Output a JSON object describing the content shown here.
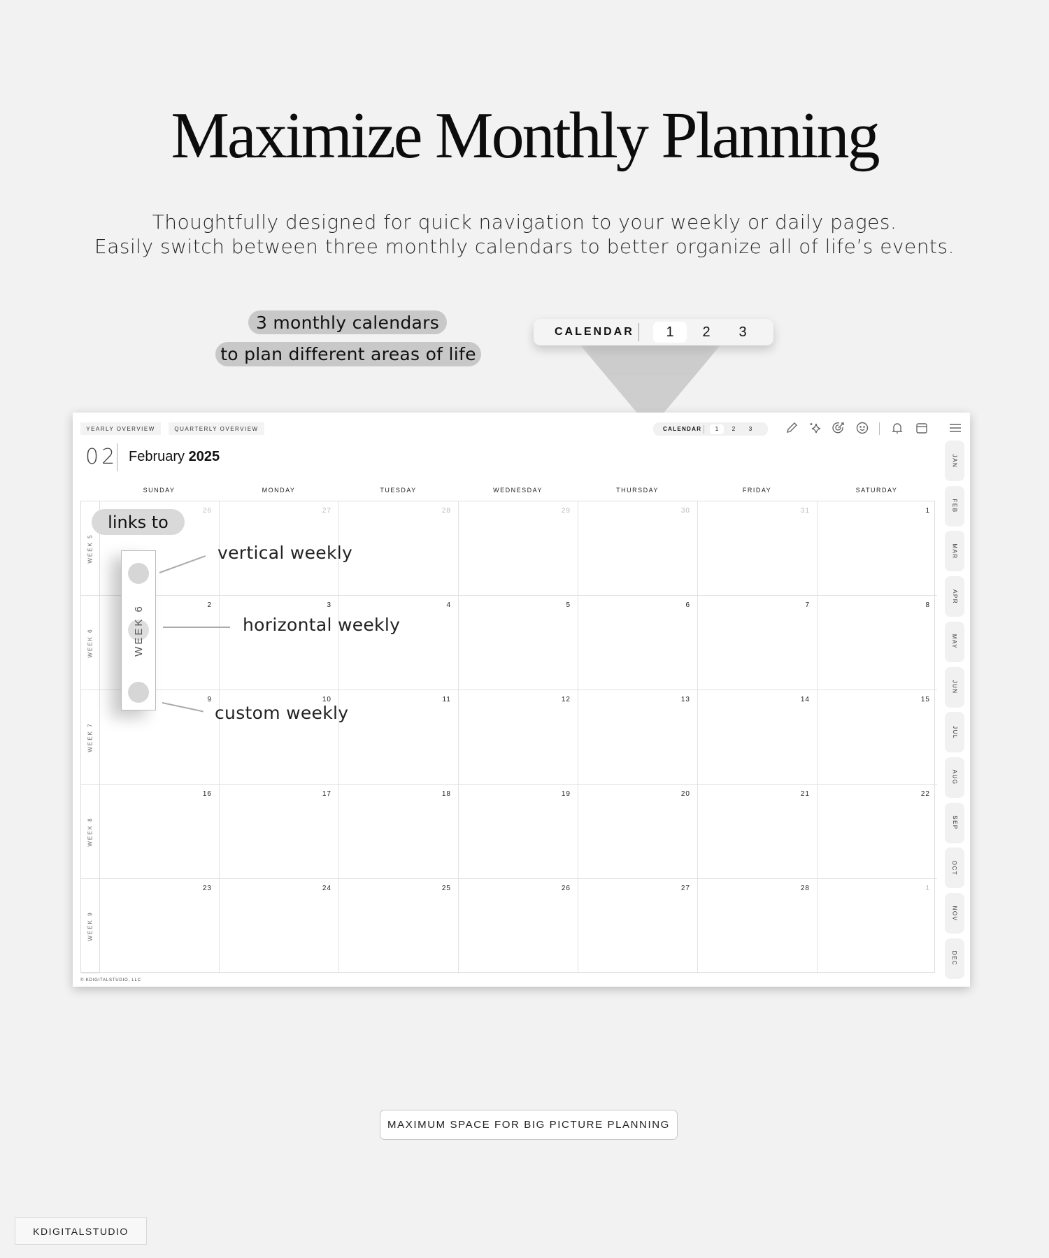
{
  "hero": {
    "title": "Maximize Monthly Planning",
    "subtitle_line1": "Thoughtfully designed for quick navigation to your weekly or daily pages.",
    "subtitle_line2": "Easily switch between three monthly calendars to better organize all of life’s events."
  },
  "annotations": {
    "note_line1": "3 monthly calendars",
    "note_line2": "to plan different areas of life",
    "links_to": "links to",
    "popup_week": "WEEK 6",
    "callouts": [
      "vertical weekly",
      "horizontal weekly",
      "custom weekly"
    ]
  },
  "calendar_switcher": {
    "label": "CALENDAR",
    "options": [
      "1",
      "2",
      "3"
    ],
    "active": "1"
  },
  "planner": {
    "nav_tabs": [
      "YEARLY OVERVIEW",
      "QUARTERLY OVERVIEW"
    ],
    "toolbar_icons": [
      "pencil-icon",
      "sparkle-icon",
      "target-icon",
      "smiley-icon",
      "bell-icon",
      "calendar-icon",
      "menu-icon"
    ],
    "month_number": "02",
    "month_name": "February",
    "year": "2025",
    "weekdays": [
      "SUNDAY",
      "MONDAY",
      "TUESDAY",
      "WEDNESDAY",
      "THURSDAY",
      "FRIDAY",
      "SATURDAY"
    ],
    "weeks": [
      {
        "label": "WEEK 5",
        "days": [
          {
            "n": "26",
            "dim": true
          },
          {
            "n": "27",
            "dim": true
          },
          {
            "n": "28",
            "dim": true
          },
          {
            "n": "29",
            "dim": true
          },
          {
            "n": "30",
            "dim": true
          },
          {
            "n": "31",
            "dim": true
          },
          {
            "n": "1",
            "dim": false
          }
        ]
      },
      {
        "label": "WEEK 6",
        "days": [
          {
            "n": "2",
            "dim": false
          },
          {
            "n": "3",
            "dim": false
          },
          {
            "n": "4",
            "dim": false
          },
          {
            "n": "5",
            "dim": false
          },
          {
            "n": "6",
            "dim": false
          },
          {
            "n": "7",
            "dim": false
          },
          {
            "n": "8",
            "dim": false
          }
        ]
      },
      {
        "label": "WEEK 7",
        "days": [
          {
            "n": "9",
            "dim": false
          },
          {
            "n": "10",
            "dim": false
          },
          {
            "n": "11",
            "dim": false
          },
          {
            "n": "12",
            "dim": false
          },
          {
            "n": "13",
            "dim": false
          },
          {
            "n": "14",
            "dim": false
          },
          {
            "n": "15",
            "dim": false
          }
        ]
      },
      {
        "label": "WEEK 8",
        "days": [
          {
            "n": "16",
            "dim": false
          },
          {
            "n": "17",
            "dim": false
          },
          {
            "n": "18",
            "dim": false
          },
          {
            "n": "19",
            "dim": false
          },
          {
            "n": "20",
            "dim": false
          },
          {
            "n": "21",
            "dim": false
          },
          {
            "n": "22",
            "dim": false
          }
        ]
      },
      {
        "label": "WEEK 9",
        "days": [
          {
            "n": "23",
            "dim": false
          },
          {
            "n": "24",
            "dim": false
          },
          {
            "n": "25",
            "dim": false
          },
          {
            "n": "26",
            "dim": false
          },
          {
            "n": "27",
            "dim": false
          },
          {
            "n": "28",
            "dim": false
          },
          {
            "n": "1",
            "dim": true
          }
        ]
      }
    ],
    "month_tabs": [
      "JAN",
      "FEB",
      "MAR",
      "APR",
      "MAY",
      "JUN",
      "JUL",
      "AUG",
      "SEP",
      "OCT",
      "NOV",
      "DEC"
    ],
    "copyright": "© KDIGITALSTUDIO, LLC"
  },
  "footer": {
    "badge": "MAXIMUM SPACE FOR BIG PICTURE PLANNING",
    "brand": "KDIGITALSTUDIO"
  }
}
